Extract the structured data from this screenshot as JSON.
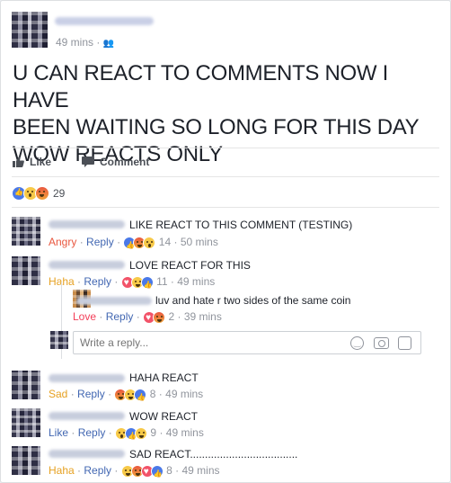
{
  "post": {
    "time": "49 mins",
    "audience_sep": "·",
    "text_lines": [
      "U CAN REACT TO COMMENTS NOW I HAVE",
      "BEEN WAITING SO LONG FOR THIS DAY",
      "WOW REACTS ONLY"
    ]
  },
  "actions": {
    "like_label": "Like",
    "comment_label": "Comment"
  },
  "reactions_summary": {
    "count": "29",
    "icons": [
      "like-icon",
      "wow-icon",
      "angry-icon"
    ]
  },
  "comments": [
    {
      "text": "LIKE REACT TO THIS COMMENT (TESTING)",
      "reaction": "Angry",
      "reply": "Reply",
      "count": "14",
      "time": "50 mins"
    },
    {
      "text": "LOVE REACT FOR THIS",
      "reaction": "Haha",
      "reply": "Reply",
      "count": "11",
      "time": "49 mins"
    },
    {
      "text": "luv and hate r two sides of the same coin",
      "reaction": "Love",
      "reply": "Reply",
      "count": "2",
      "time": "39 mins"
    },
    {
      "text": "HAHA REACT",
      "reaction": "Sad",
      "reply": "Reply",
      "count": "8",
      "time": "49 mins"
    },
    {
      "text": "WOW REACT",
      "reaction": "Like",
      "reply": "Reply",
      "count": "9",
      "time": "49 mins"
    },
    {
      "text": "SAD REACT....................................",
      "reaction": "Haha",
      "reply": "Reply",
      "count": "8",
      "time": "49 mins"
    }
  ],
  "reply_box": {
    "placeholder": "Write a reply..."
  },
  "colors": {
    "reply_blue": "#4267b2",
    "angry": "#e9573f",
    "haha": "#e6a122",
    "love": "#f33e58",
    "like": "#4267b2"
  }
}
